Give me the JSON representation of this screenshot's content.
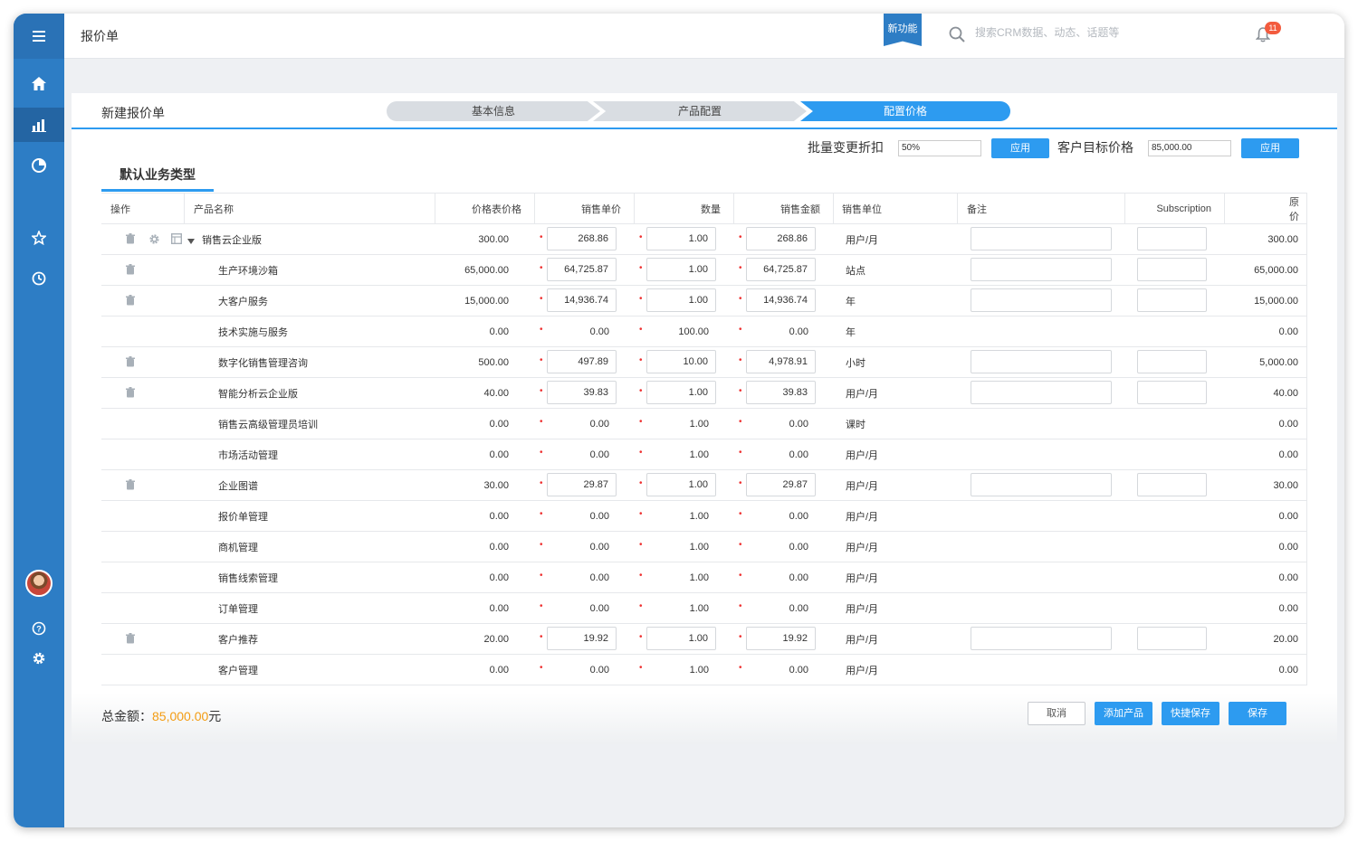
{
  "app": {
    "title": "报价单",
    "new_feature": "新功能",
    "search_placeholder": "搜索CRM数据、动态、话题等",
    "notification_count": "11"
  },
  "sidebar": {
    "items": [
      {
        "icon": "home-icon"
      },
      {
        "icon": "bar-chart-icon",
        "active": true
      },
      {
        "icon": "pie-chart-icon"
      },
      {
        "icon": "star-icon"
      },
      {
        "icon": "clock-icon"
      },
      {
        "icon": "help-icon"
      },
      {
        "icon": "settings-icon"
      }
    ]
  },
  "page": {
    "title": "新建报价单",
    "steps": [
      "基本信息",
      "产品配置",
      "配置价格"
    ],
    "active_step": 3,
    "batch_discount_label": "批量变更折扣",
    "batch_discount_value": "50%",
    "apply_label": "应用",
    "target_price_label": "客户目标价格",
    "target_price_value": "85,000.00",
    "section_tab": "默认业务类型"
  },
  "table": {
    "columns": [
      "操作",
      "产品名称",
      "价格表价格",
      "销售单价",
      "数量",
      "销售金额",
      "销售单位",
      "备注",
      "Subscription",
      "原价"
    ],
    "rows": [
      {
        "name": "销售云企业版",
        "list_price": "300.00",
        "unit_price": "268.86",
        "qty": "1.00",
        "amount": "268.86",
        "unit": "用户/月",
        "original": "300.00",
        "editable": true,
        "parent": true
      },
      {
        "name": "生产环境沙箱",
        "list_price": "65,000.00",
        "unit_price": "64,725.87",
        "qty": "1.00",
        "amount": "64,725.87",
        "unit": "站点",
        "original": "65,000.00",
        "editable": true
      },
      {
        "name": "大客户服务",
        "list_price": "15,000.00",
        "unit_price": "14,936.74",
        "qty": "1.00",
        "amount": "14,936.74",
        "unit": "年",
        "original": "15,000.00",
        "editable": true
      },
      {
        "name": "技术实施与服务",
        "list_price": "0.00",
        "unit_price": "0.00",
        "qty": "100.00",
        "amount": "0.00",
        "unit": "年",
        "original": "0.00",
        "editable": false
      },
      {
        "name": "数字化销售管理咨询",
        "list_price": "500.00",
        "unit_price": "497.89",
        "qty": "10.00",
        "amount": "4,978.91",
        "unit": "小时",
        "original": "5,000.00",
        "editable": true
      },
      {
        "name": "智能分析云企业版",
        "list_price": "40.00",
        "unit_price": "39.83",
        "qty": "1.00",
        "amount": "39.83",
        "unit": "用户/月",
        "original": "40.00",
        "editable": true
      },
      {
        "name": "销售云高级管理员培训",
        "list_price": "0.00",
        "unit_price": "0.00",
        "qty": "1.00",
        "amount": "0.00",
        "unit": "课时",
        "original": "0.00",
        "editable": false
      },
      {
        "name": "市场活动管理",
        "list_price": "0.00",
        "unit_price": "0.00",
        "qty": "1.00",
        "amount": "0.00",
        "unit": "用户/月",
        "original": "0.00",
        "editable": false
      },
      {
        "name": "企业图谱",
        "list_price": "30.00",
        "unit_price": "29.87",
        "qty": "1.00",
        "amount": "29.87",
        "unit": "用户/月",
        "original": "30.00",
        "editable": true
      },
      {
        "name": "报价单管理",
        "list_price": "0.00",
        "unit_price": "0.00",
        "qty": "1.00",
        "amount": "0.00",
        "unit": "用户/月",
        "original": "0.00",
        "editable": false
      },
      {
        "name": "商机管理",
        "list_price": "0.00",
        "unit_price": "0.00",
        "qty": "1.00",
        "amount": "0.00",
        "unit": "用户/月",
        "original": "0.00",
        "editable": false
      },
      {
        "name": "销售线索管理",
        "list_price": "0.00",
        "unit_price": "0.00",
        "qty": "1.00",
        "amount": "0.00",
        "unit": "用户/月",
        "original": "0.00",
        "editable": false
      },
      {
        "name": "订单管理",
        "list_price": "0.00",
        "unit_price": "0.00",
        "qty": "1.00",
        "amount": "0.00",
        "unit": "用户/月",
        "original": "0.00",
        "editable": false
      },
      {
        "name": "客户推荐",
        "list_price": "20.00",
        "unit_price": "19.92",
        "qty": "1.00",
        "amount": "19.92",
        "unit": "用户/月",
        "original": "20.00",
        "editable": true
      },
      {
        "name": "客户管理",
        "list_price": "0.00",
        "unit_price": "0.00",
        "qty": "1.00",
        "amount": "0.00",
        "unit": "用户/月",
        "original": "0.00",
        "editable": false
      }
    ]
  },
  "footer": {
    "total_label": "总金额：",
    "total_value": "85,000.00",
    "total_unit": "元",
    "buttons": {
      "cancel": "取消",
      "add_product": "添加产品",
      "quick_save": "快捷保存",
      "save": "保存"
    }
  },
  "colors": {
    "sidebar": "#2d7dc5",
    "accent": "#2d9bf0",
    "total": "#f39c12",
    "required": "#e33333"
  }
}
